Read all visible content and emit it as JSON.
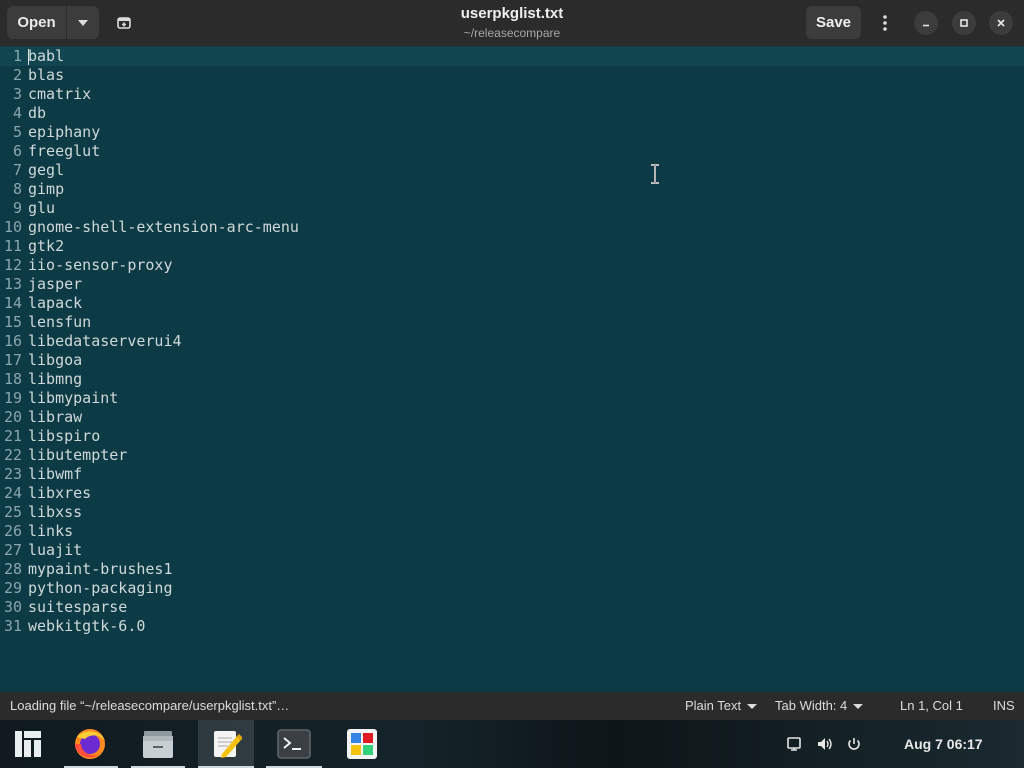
{
  "header": {
    "open_label": "Open",
    "title": "userpkglist.txt",
    "subtitle": "~/releasecompare",
    "save_label": "Save"
  },
  "editor": {
    "lines": [
      {
        "n": "1",
        "text": "babl"
      },
      {
        "n": "2",
        "text": "blas"
      },
      {
        "n": "3",
        "text": "cmatrix"
      },
      {
        "n": "4",
        "text": "db"
      },
      {
        "n": "5",
        "text": "epiphany"
      },
      {
        "n": "6",
        "text": "freeglut"
      },
      {
        "n": "7",
        "text": "gegl"
      },
      {
        "n": "8",
        "text": "gimp"
      },
      {
        "n": "9",
        "text": "glu"
      },
      {
        "n": "10",
        "text": "gnome-shell-extension-arc-menu"
      },
      {
        "n": "11",
        "text": "gtk2"
      },
      {
        "n": "12",
        "text": "iio-sensor-proxy"
      },
      {
        "n": "13",
        "text": "jasper"
      },
      {
        "n": "14",
        "text": "lapack"
      },
      {
        "n": "15",
        "text": "lensfun"
      },
      {
        "n": "16",
        "text": "libedataserverui4"
      },
      {
        "n": "17",
        "text": "libgoa"
      },
      {
        "n": "18",
        "text": "libmng"
      },
      {
        "n": "19",
        "text": "libmypaint"
      },
      {
        "n": "20",
        "text": "libraw"
      },
      {
        "n": "21",
        "text": "libspiro"
      },
      {
        "n": "22",
        "text": "libutempter"
      },
      {
        "n": "23",
        "text": "libwmf"
      },
      {
        "n": "24",
        "text": "libxres"
      },
      {
        "n": "25",
        "text": "libxss"
      },
      {
        "n": "26",
        "text": "links"
      },
      {
        "n": "27",
        "text": "luajit"
      },
      {
        "n": "28",
        "text": "mypaint-brushes1"
      },
      {
        "n": "29",
        "text": "python-packaging"
      },
      {
        "n": "30",
        "text": "suitesparse"
      },
      {
        "n": "31",
        "text": "webkitgtk-6.0"
      }
    ]
  },
  "statusbar": {
    "message": "Loading file “~/releasecompare/userpkglist.txt”…",
    "language": "Plain Text",
    "tab_width": "Tab Width: 4",
    "position": "Ln 1, Col 1",
    "mode": "INS"
  },
  "taskbar": {
    "apps": [
      "menu-icon",
      "firefox-icon",
      "files-icon",
      "text-editor-icon",
      "terminal-icon",
      "software-icon"
    ],
    "clock": "Aug 7  06:17"
  },
  "colors": {
    "editor_bg": "#0c3a45",
    "header_bg": "#2b2b2b"
  }
}
